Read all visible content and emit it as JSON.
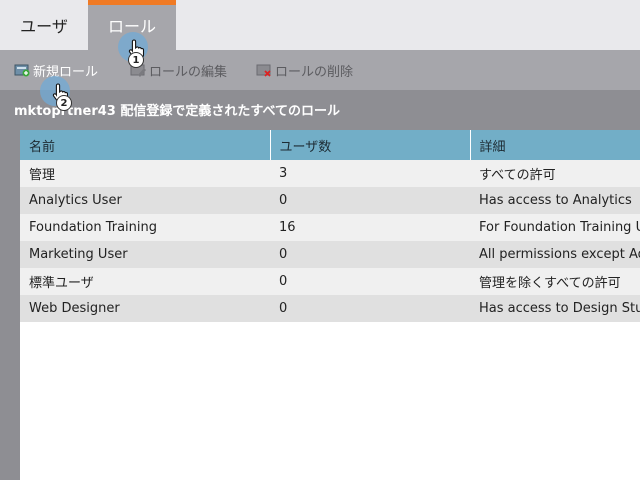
{
  "tabs": [
    {
      "label": "ユーザ"
    },
    {
      "label": "ロール"
    }
  ],
  "toolbar": {
    "new_role": "新規ロール",
    "edit_role": "ロールの編集",
    "delete_role": "ロールの削除"
  },
  "section_title": "mktoprtner43 配信登録で定義されたすべてのロール",
  "table": {
    "headers": [
      "名前",
      "ユーザ数",
      "詳細"
    ],
    "rows": [
      {
        "name": "管理",
        "users": "3",
        "details": "すべての許可"
      },
      {
        "name": "Analytics User",
        "users": "0",
        "details": "Has access to Analytics"
      },
      {
        "name": "Foundation Training",
        "users": "16",
        "details": "For Foundation Training Us"
      },
      {
        "name": "Marketing User",
        "users": "0",
        "details": "All permissions except Adm"
      },
      {
        "name": "標準ユーザ",
        "users": "0",
        "details": "管理を除くすべての許可"
      },
      {
        "name": "Web Designer",
        "users": "0",
        "details": "Has access to Design Studio"
      }
    ]
  },
  "callouts": [
    "1",
    "2"
  ],
  "colors": {
    "accent": "#f07a24",
    "header": "#72aec7",
    "toolbar": "#a6a6ab",
    "background": "#8e8e93"
  },
  "icons": [
    "new-role-icon",
    "edit-role-icon",
    "delete-role-icon",
    "hand-cursor-icon"
  ]
}
